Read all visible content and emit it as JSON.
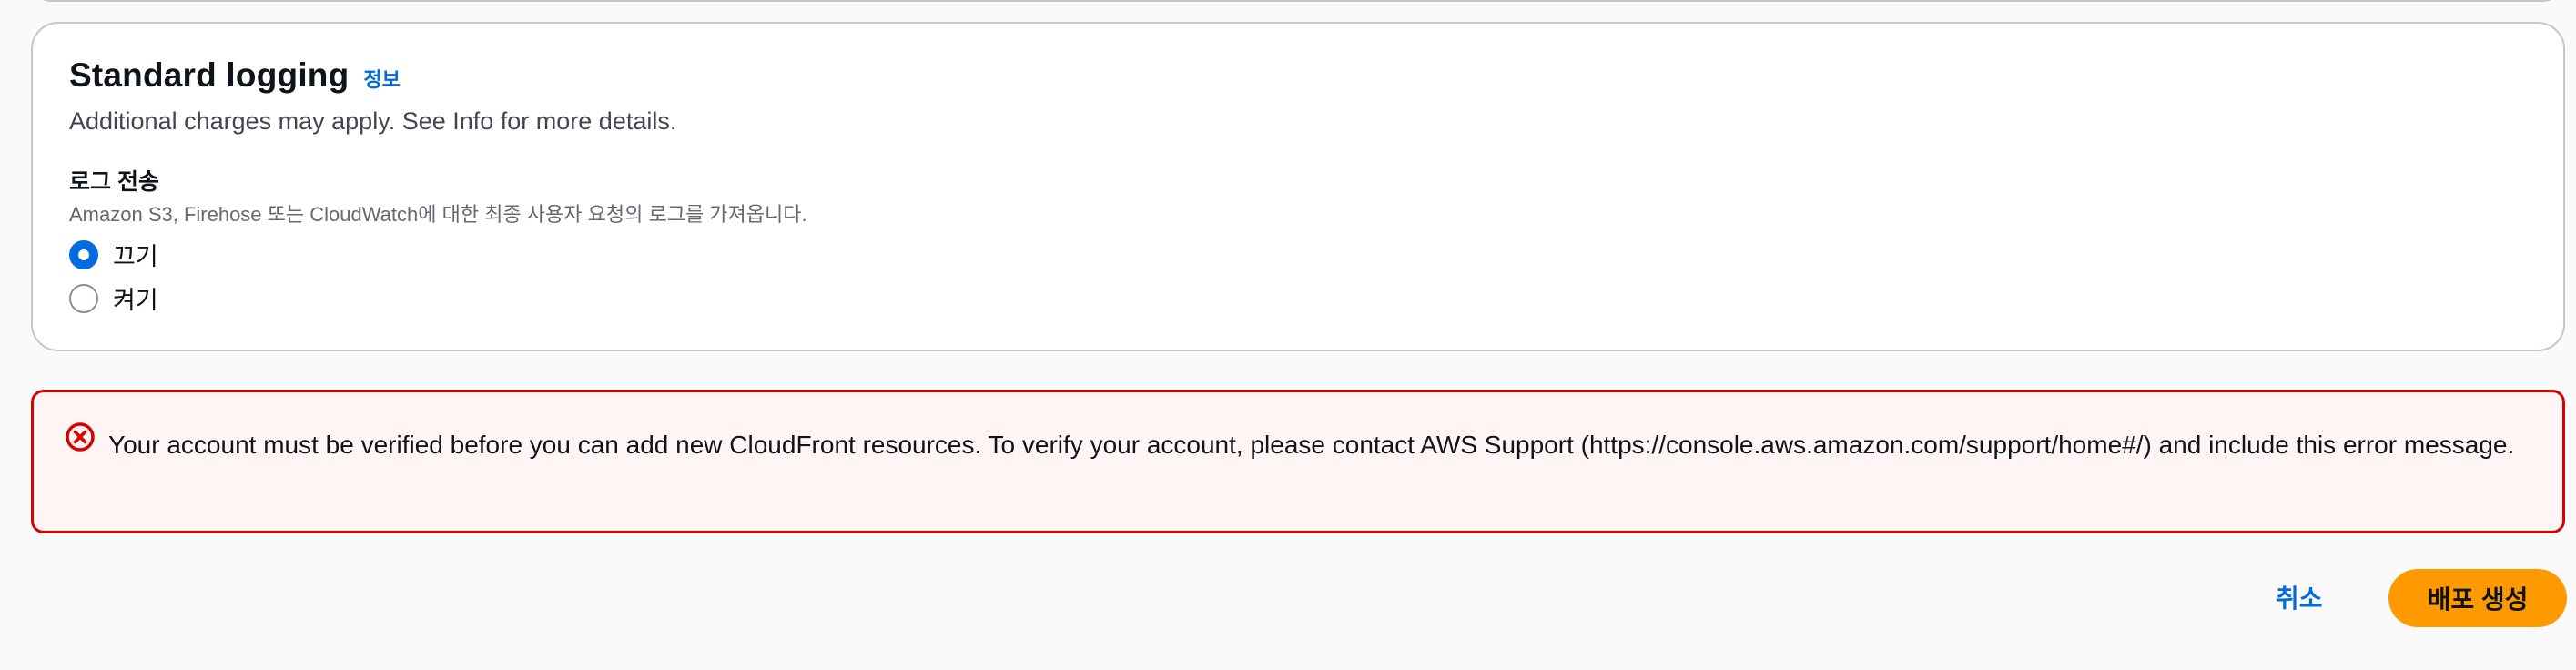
{
  "logging_card": {
    "title": "Standard logging",
    "info_link": "정보",
    "description": "Additional charges may apply. See Info for more details.",
    "field": {
      "label": "로그 전송",
      "description": "Amazon S3, Firehose 또는 CloudWatch에 대한 최종 사용자 요청의 로그를 가져옵니다.",
      "options": [
        {
          "label": "끄기",
          "selected": true
        },
        {
          "label": "켜기",
          "selected": false
        }
      ]
    }
  },
  "error_alert": {
    "icon": "error-circle-x-icon",
    "message": "Your account must be verified before you can add new CloudFront resources. To verify your account, please contact AWS Support (https://console.aws.amazon.com/support/home#/) and include this error message.",
    "color": "#db0000"
  },
  "footer": {
    "cancel_label": "취소",
    "submit_label": "배포 생성"
  },
  "colors": {
    "primary_button": "#ff9900",
    "link": "#006ce0",
    "radio_selected": "#006ce0"
  }
}
